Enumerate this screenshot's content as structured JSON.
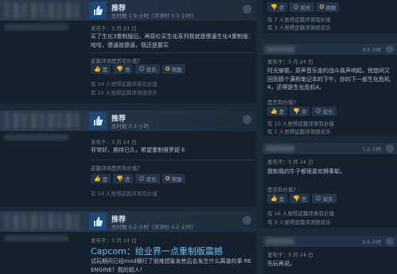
{
  "reviews_left": [
    {
      "verdict": "推荐",
      "hours": "总时数 1.9 小时（评测时 0.3 小时）",
      "posted": "发布于：3 月 24 日",
      "body": "买了生化3重制版后，再原价买生化系列我就是傻逼生化4重制版：哈哈，傻逼就傻逼，我还是要买",
      "helpful_q": "这篇评测是否有价值？",
      "buttons": [
        "是",
        "否",
        "欢乐",
        "奖励"
      ],
      "stats": [
        "有 24 人觉得这篇评测有价值",
        "有 15 人觉得这篇评测很欢乐"
      ]
    },
    {
      "verdict": "推荐",
      "hours": "总时数 0.3 小时",
      "posted": "发布于：3 月 24 日",
      "body": "非常好，期待已久，希望重制维罗妮卡",
      "helpful_q": "这篇评测是否有价值？",
      "buttons": [
        "是",
        "否",
        "欢乐",
        "奖励"
      ],
      "stats": [
        "有 19 人觉得这篇评测有价值"
      ]
    },
    {
      "verdict": "推荐",
      "hours": "总时数 0.2 小时（评测时 0.2 小时）",
      "posted": "发布于：3 月 24 日",
      "title": "Capcom：给业界一点重制版震撼",
      "body": "试玩期间已经mod横行了很难想象发售后会发生什么离谱的事 RE ENGINE！我的超人！"
    }
  ],
  "reviews_right": [
    {
      "buttons": [
        "否",
        "欢乐",
        "奖励"
      ],
      "stats": [
        "有 7 人觉得这篇评测有价值",
        "有 3 人觉得这篇评测很欢乐"
      ]
    },
    {
      "hours": "0.5 小时",
      "posted": "发布于：3 月 24 日",
      "body": "时光穿梭，原声音乐金的战斗装声响起，恍惚间又回到那个满杨笔记本的下午。你的下一部生化危机 4，还得是生化危机4。",
      "helpful_q": "是否有价值？",
      "buttons": [
        "是",
        "否",
        "欢乐"
      ],
      "stats": [
        "有 10 人觉得这篇评测有价值",
        "有 1 人觉得这篇评测很欢乐"
      ]
    },
    {
      "hours": "1.0 小时",
      "posted": "发布于：3 月 24 日",
      "body": "我和我的牛子都很喜欢狮事犁。",
      "helpful_q": "是否有价值？",
      "buttons": [
        "是",
        "否",
        "欢乐"
      ],
      "stats": [
        "有 16 人觉得这篇评测有价值",
        "有 3 人觉得这篇评测很欢乐"
      ]
    },
    {
      "hours": "0.6 小时",
      "posted": "发布于：3 月 24 日",
      "body": "先玩再说。"
    }
  ]
}
